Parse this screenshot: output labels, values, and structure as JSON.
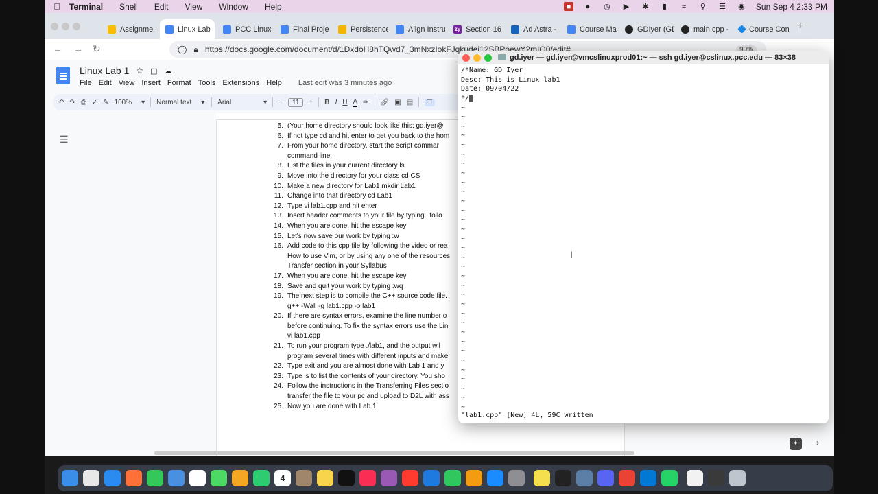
{
  "menubar": {
    "app": "Terminal",
    "items": [
      "Shell",
      "Edit",
      "View",
      "Window",
      "Help"
    ],
    "clock": "Sun Sep 4  2:33 PM"
  },
  "browser": {
    "tabs": [
      {
        "label": "Assignment",
        "icon": "drive-icon",
        "color": "#fbbc04"
      },
      {
        "label": "Linux Lab",
        "icon": "docs-icon",
        "color": "#4285f4",
        "active": true
      },
      {
        "label": "PCC Linux",
        "icon": "docs-icon",
        "color": "#4285f4"
      },
      {
        "label": "Final Projec",
        "icon": "docs-icon",
        "color": "#4285f4"
      },
      {
        "label": "Persistence",
        "icon": "slides-icon",
        "color": "#f4b400"
      },
      {
        "label": "Align Instru",
        "icon": "docs-icon",
        "color": "#4285f4"
      },
      {
        "label": "Section 16",
        "icon": "zybooks-icon",
        "color": "#7b1fa2"
      },
      {
        "label": "Ad Astra -",
        "icon": "astra-icon",
        "color": "#1565c0"
      },
      {
        "label": "Course Map",
        "icon": "docs-icon",
        "color": "#4285f4"
      },
      {
        "label": "GDIyer (GD",
        "icon": "github-icon",
        "color": "#222222"
      },
      {
        "label": "main.cpp -",
        "icon": "github-icon",
        "color": "#222222"
      },
      {
        "label": "Course Con",
        "icon": "course-icon",
        "color": "#1e88e5"
      }
    ],
    "url": "https://docs.google.com/document/d/1DxdoH8hTQwd7_3mNxzIokFJqkudej12SBPoewY2mIQ0/edit#",
    "zoom": "90%"
  },
  "docs": {
    "title": "Linux Lab 1",
    "menu": [
      "File",
      "Edit",
      "View",
      "Insert",
      "Format",
      "Tools",
      "Extensions",
      "Help"
    ],
    "last_edit": "Last edit was 3 minutes ago",
    "zoom": "100%",
    "style": "Normal text",
    "font": "Arial",
    "font_size": "11",
    "steps": [
      {
        "num": "5.",
        "lines": [
          "(Your home directory should look like this: gd.iyer@"
        ]
      },
      {
        "num": "6.",
        "lines": [
          "If not type cd and hit enter to get you back to the hom"
        ]
      },
      {
        "num": "7.",
        "lines": [
          "From your home directory, start the script commar",
          "command line."
        ]
      },
      {
        "num": "8.",
        "lines": [
          "List the files in your current directory ls"
        ]
      },
      {
        "num": "9.",
        "lines": [
          "Move into the directory for your class           cd   CS"
        ]
      },
      {
        "num": "10.",
        "lines": [
          "Make a new directory for Lab1       mkdir Lab1"
        ]
      },
      {
        "num": "11.",
        "lines": [
          "Change into that directory      cd Lab1"
        ]
      },
      {
        "num": "12.",
        "lines": [
          "Type vi lab1.cpp and hit enter"
        ]
      },
      {
        "num": "13.",
        "lines": [
          "Insert header comments to your file by typing  i  follo"
        ]
      },
      {
        "num": "14.",
        "lines": [
          "When you are done, hit the escape key"
        ]
      },
      {
        "num": "15.",
        "lines": [
          "Let's now save our work by typing :w"
        ]
      },
      {
        "num": "16.",
        "lines": [
          "Add code to this cpp file by following the video or rea",
          "How to use Vim, or by using any one of the resources",
          "Transfer section in your Syllabus"
        ]
      },
      {
        "num": "17.",
        "lines": [
          "When you are done, hit the escape key"
        ]
      },
      {
        "num": "18.",
        "lines": [
          "Save and quit your work by typing :wq"
        ]
      },
      {
        "num": "19.",
        "lines": [
          "The next step is to compile the C++ source code file.",
          "g++ -Wall -g lab1.cpp -o lab1"
        ]
      },
      {
        "num": "20.",
        "lines": [
          "If there are syntax errors, examine the line number o",
          "before continuing. To fix the syntax errors use the Lin",
          "vi lab1.cpp"
        ]
      },
      {
        "num": "21.",
        "lines": [
          "To run your program type ./lab1, and the output wil",
          "program several times with different inputs and make"
        ]
      },
      {
        "num": "22.",
        "lines": [
          "Type exit and you are almost done with Lab 1 and y"
        ]
      },
      {
        "num": "23.",
        "lines": [
          "Type ls to list the contents of your directory. You sho"
        ]
      },
      {
        "num": "24.",
        "lines": [
          "Follow the instructions in the Transferring Files sectio",
          "transfer the file to your pc and upload to D2L with ass"
        ]
      },
      {
        "num": "25.",
        "lines": [
          "Now you are done with Lab 1."
        ]
      }
    ]
  },
  "terminal": {
    "title": "gd.iyer — gd.iyer@vmcslinuxprod01:~ — ssh gd.iyer@cslinux.pcc.edu — 83×38",
    "lines": [
      "/*Name: GD Iyer",
      "Desc: This is Linux lab1",
      "Date: 09/04/22"
    ],
    "cursor_line": "*/",
    "tilde": "~",
    "status": "\"lab1.cpp\" [New] 4L, 59C written"
  },
  "dock": {
    "calendar_day": "4",
    "apps": [
      {
        "name": "finder-icon",
        "color": "#3b8ee8"
      },
      {
        "name": "launchpad-icon",
        "color": "#e8e8e8"
      },
      {
        "name": "safari-icon",
        "color": "#2a8cf0"
      },
      {
        "name": "firefox-icon",
        "color": "#ff7139"
      },
      {
        "name": "messages-icon",
        "color": "#34c759"
      },
      {
        "name": "mail-icon",
        "color": "#4a90e2"
      },
      {
        "name": "reminders-icon",
        "color": "#ffffff"
      },
      {
        "name": "maps-icon",
        "color": "#4cd964"
      },
      {
        "name": "photos-icon",
        "color": "#f5a623"
      },
      {
        "name": "facetime-icon",
        "color": "#2ecc71"
      },
      {
        "name": "calendar-icon",
        "color": "#ffffff"
      },
      {
        "name": "contacts-icon",
        "color": "#a0866a"
      },
      {
        "name": "notes-icon",
        "color": "#f7d44c"
      },
      {
        "name": "tv-icon",
        "color": "#111111"
      },
      {
        "name": "music-icon",
        "color": "#fa2d55"
      },
      {
        "name": "podcasts-icon",
        "color": "#9b59b6"
      },
      {
        "name": "news-icon",
        "color": "#ff3b30"
      },
      {
        "name": "keynote-icon",
        "color": "#1f7ae0"
      },
      {
        "name": "numbers-icon",
        "color": "#30c85e"
      },
      {
        "name": "pages-icon",
        "color": "#f39c12"
      },
      {
        "name": "appstore-icon",
        "color": "#1a8cff"
      },
      {
        "name": "settings-icon",
        "color": "#8e8e93"
      },
      {
        "name": "stickies-icon",
        "color": "#f4e04d"
      },
      {
        "name": "terminal-icon",
        "color": "#222222"
      },
      {
        "name": "preview-icon",
        "color": "#5b7fa6"
      },
      {
        "name": "discord-icon",
        "color": "#5865f2"
      },
      {
        "name": "chrome-icon",
        "color": "#ea4335"
      },
      {
        "name": "vscode-icon",
        "color": "#0078d4"
      },
      {
        "name": "whatsapp-icon",
        "color": "#25d366"
      },
      {
        "name": "document-icon",
        "color": "#f2f2f2"
      },
      {
        "name": "folder-icon",
        "color": "#3a3a3a"
      },
      {
        "name": "trash-icon",
        "color": "#bfc5cc"
      }
    ]
  }
}
